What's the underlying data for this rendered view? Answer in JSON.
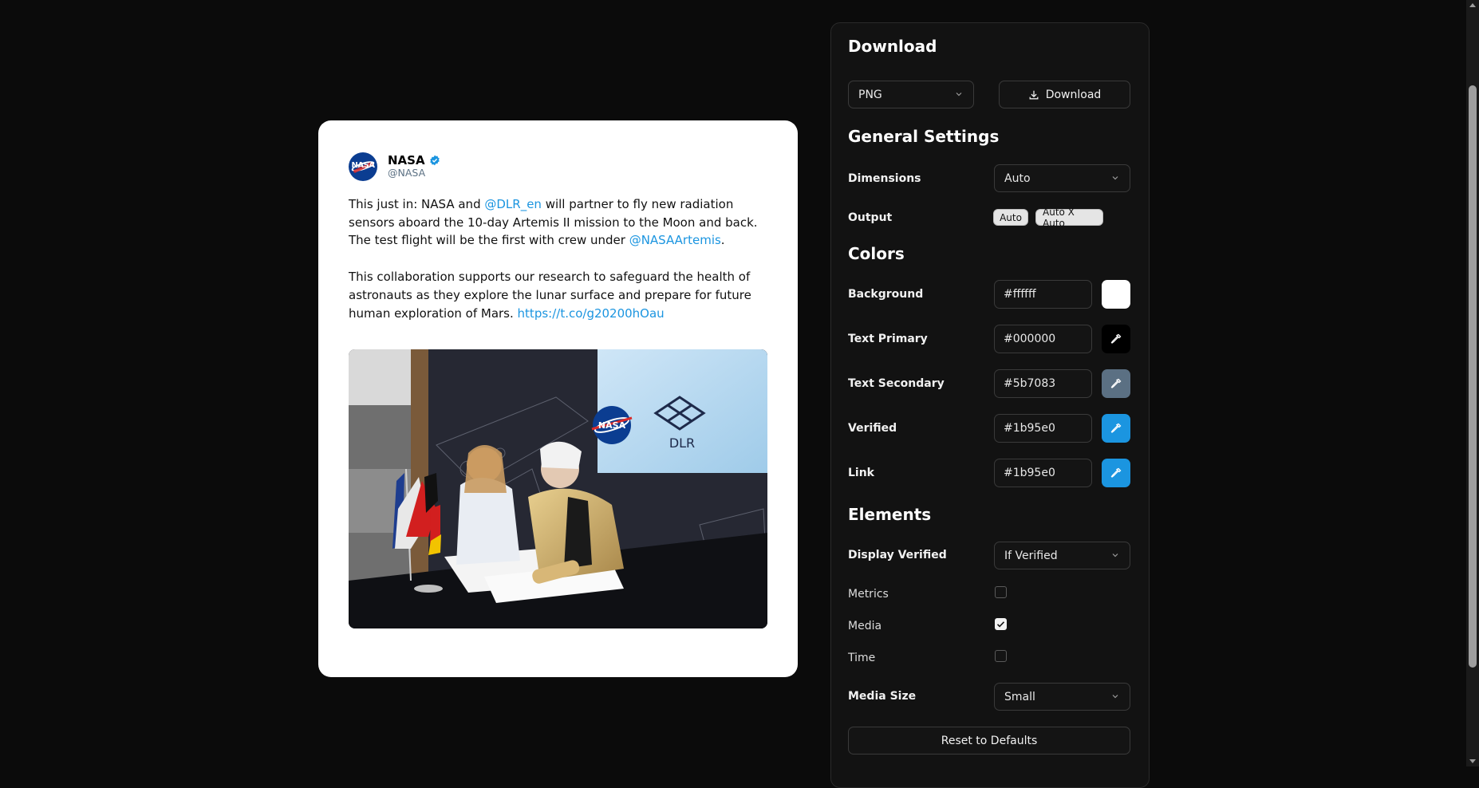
{
  "tweet": {
    "name": "NASA",
    "handle": "@NASA",
    "body1_pre": "This just in: NASA and ",
    "body1_link1": "@DLR_en",
    "body1_mid": " will partner to fly new radiation sensors aboard the 10-day Artemis II mission to the Moon and back. The test flight will be the first with crew under ",
    "body1_link2": "@NASAArtemis",
    "body1_end": ".",
    "body2_pre": "This collaboration supports our research to safeguard the health of astronauts as they explore the lunar surface and prepare for future human exploration of Mars. ",
    "body2_link": "https://t.co/g20200hOau",
    "media_logo_text": "DLR"
  },
  "panel": {
    "download": {
      "title": "Download",
      "format": "PNG",
      "button": "Download"
    },
    "general": {
      "title": "General Settings",
      "dimensions_label": "Dimensions",
      "dimensions_value": "Auto",
      "output_label": "Output",
      "output_badges": [
        "Auto",
        "Auto X Auto"
      ]
    },
    "colors": {
      "title": "Colors",
      "items": [
        {
          "label": "Background",
          "value": "#ffffff",
          "swatch": "#ffffff"
        },
        {
          "label": "Text Primary",
          "value": "#000000",
          "swatch": "#000000"
        },
        {
          "label": "Text Secondary",
          "value": "#5b7083",
          "swatch": "#5b7083"
        },
        {
          "label": "Verified",
          "value": "#1b95e0",
          "swatch": "#1b95e0"
        },
        {
          "label": "Link",
          "value": "#1b95e0",
          "swatch": "#1b95e0"
        }
      ]
    },
    "elements": {
      "title": "Elements",
      "display_verified_label": "Display Verified",
      "display_verified_value": "If Verified",
      "metrics_label": "Metrics",
      "metrics_checked": false,
      "media_label": "Media",
      "media_checked": true,
      "time_label": "Time",
      "time_checked": false,
      "media_size_label": "Media Size",
      "media_size_value": "Small"
    },
    "reset_button": "Reset to Defaults"
  }
}
